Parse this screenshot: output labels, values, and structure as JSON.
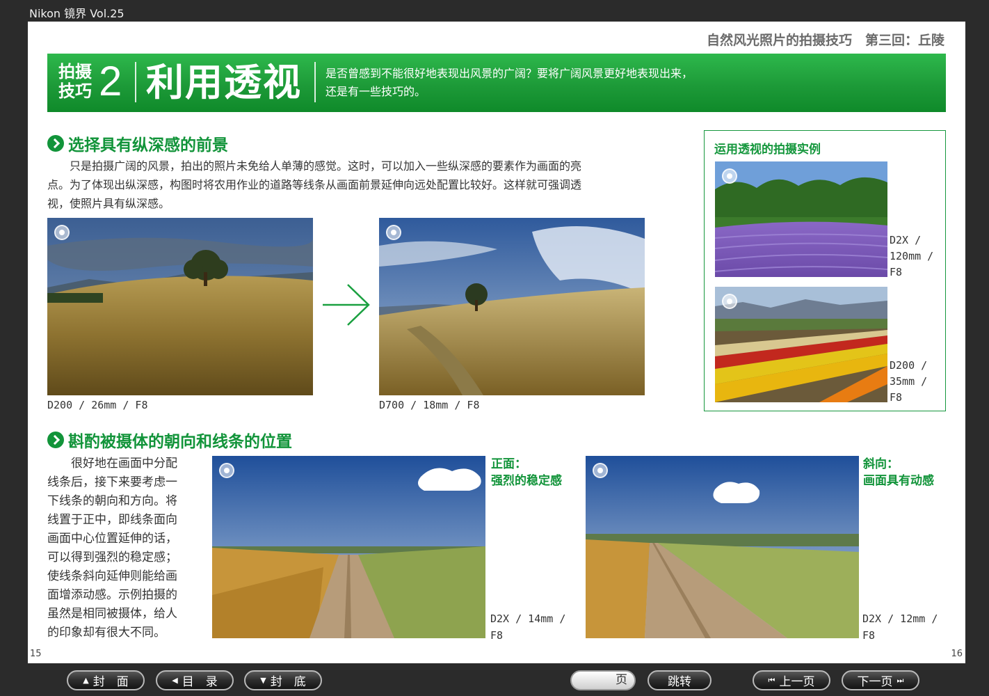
{
  "window": {
    "title": "Nikon 镜界 Vol.25"
  },
  "page": {
    "series_title": "自然风光照片的拍摄技巧　第三回：丘陵",
    "banner": {
      "label_line1": "拍摄",
      "label_line2": "技巧",
      "number": "2",
      "title": "利用透视",
      "desc_line1": "是否曾感到不能很好地表现出风景的广阔？要将广阔风景更好地表现出来，",
      "desc_line2": "还是有一些技巧的。"
    },
    "section1": {
      "heading": "选择具有纵深感的前景",
      "text_line1": "　　只是拍摄广阔的风景，拍出的照片未免给人单薄的感觉。这时，可以加入一些纵深感的要素作为画面的亮",
      "text_line2": "点。为了体现出纵深感，构图时将农用作业的道路等线条从画面前景延伸向远处配置比较好。这样就可强调透",
      "text_line3": "视，使照片具有纵深感。",
      "photo1_caption": "D200 / 26mm / F8",
      "photo2_caption": "D700 / 18mm / F8"
    },
    "example_box": {
      "title": "运用透视的拍摄实例",
      "photo1_caption_l1": "D2X /",
      "photo1_caption_l2": "120mm /",
      "photo1_caption_l3": "F8",
      "photo2_caption_l1": "D200 /",
      "photo2_caption_l2": "35mm /",
      "photo2_caption_l3": "F8"
    },
    "section2": {
      "heading": "斟酌被摄体的朝向和线条的位置",
      "text_lines": [
        "　　很好地在画面中分配",
        "线条后，接下来要考虑一",
        "下线条的朝向和方向。将",
        "线置于正中，即线条面向",
        "画面中心位置延伸的话，",
        "可以得到强烈的稳定感；",
        "使线条斜向延伸则能给画",
        "面增添动感。示例拍摄的",
        "虽然是相同被摄体，给人",
        "的印象却有很大不同。"
      ],
      "photo1_note_l1": "正面：",
      "photo1_note_l2": "强烈的稳定感",
      "photo1_caption_l1": "D2X / 14mm /",
      "photo1_caption_l2": "F8",
      "photo2_note_l1": "斜向：",
      "photo2_note_l2": "画面具有动感",
      "photo2_caption_l1": "D2X / 12mm /",
      "photo2_caption_l2": "F8"
    },
    "page_left": "15",
    "page_right": "16"
  },
  "toolbar": {
    "cover_label": "封　面",
    "toc_label": "目　录",
    "back_label": "封　底",
    "page_input_value": "页",
    "jump_label": "跳转",
    "prev_label": "上一页",
    "next_label": "下一页"
  },
  "colors": {
    "accent_green": "#12943a",
    "banner_green": "#1d9a38",
    "background": "#2b2b2b"
  }
}
